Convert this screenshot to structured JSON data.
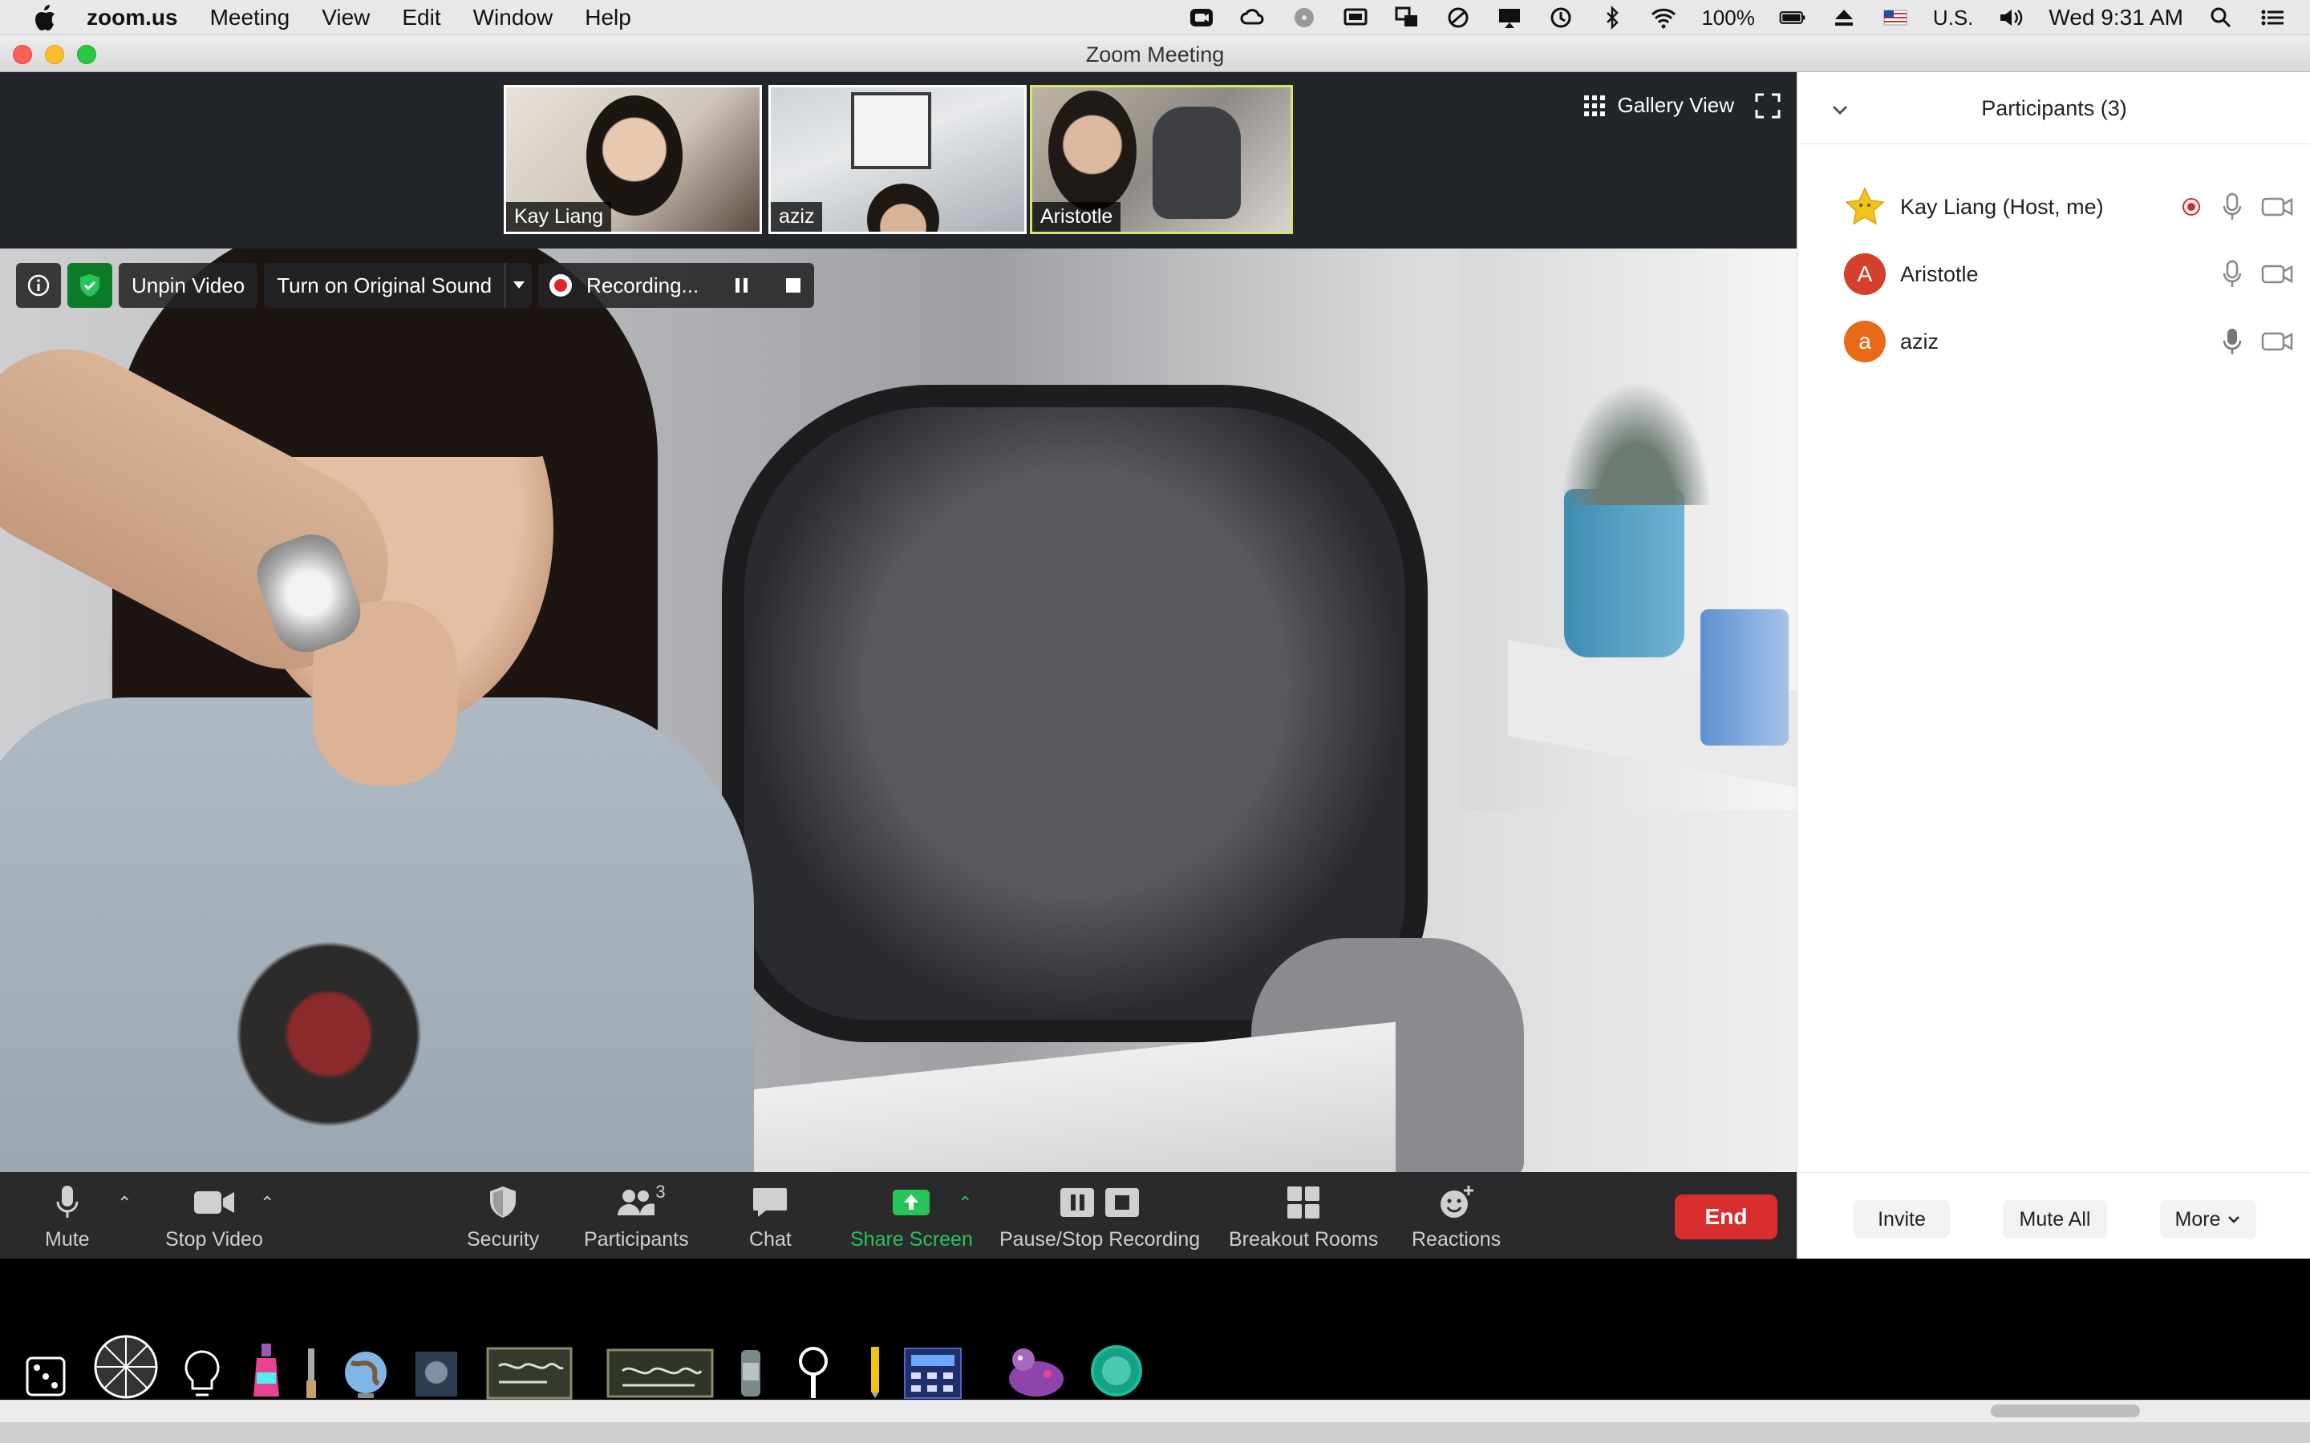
{
  "menubar": {
    "app_name": "zoom.us",
    "items": [
      "Meeting",
      "View",
      "Edit",
      "Window",
      "Help"
    ],
    "battery": "100%",
    "input_source": "U.S.",
    "clock": "Wed 9:31 AM"
  },
  "window": {
    "title": "Zoom Meeting"
  },
  "thumbnails": [
    {
      "name": "Kay Liang"
    },
    {
      "name": "aziz"
    },
    {
      "name": "Aristotle"
    }
  ],
  "view_controls": {
    "gallery_label": "Gallery View"
  },
  "video_toolbar": {
    "unpin": "Unpin Video",
    "original_sound": "Turn on Original Sound",
    "recording": "Recording..."
  },
  "controls": {
    "mute": "Mute",
    "stop_video": "Stop Video",
    "security": "Security",
    "participants": "Participants",
    "participants_count": "3",
    "chat": "Chat",
    "share_screen": "Share Screen",
    "pause_stop_recording": "Pause/Stop Recording",
    "breakout_rooms": "Breakout Rooms",
    "reactions": "Reactions",
    "end": "End"
  },
  "panel": {
    "title": "Participants (3)",
    "participants": [
      {
        "name": "Kay Liang (Host, me)",
        "avatar": "star",
        "color": "#e8c21a"
      },
      {
        "name": "Aristotle",
        "initial": "A",
        "color": "#d4402b"
      },
      {
        "name": "aziz",
        "initial": "a",
        "color": "#e66a17"
      }
    ],
    "invite": "Invite",
    "mute_all": "Mute All",
    "more": "More"
  },
  "colors": {
    "end_button": "#d92e2e",
    "share_green": "#27c45a",
    "recording_red": "#e0232e"
  }
}
